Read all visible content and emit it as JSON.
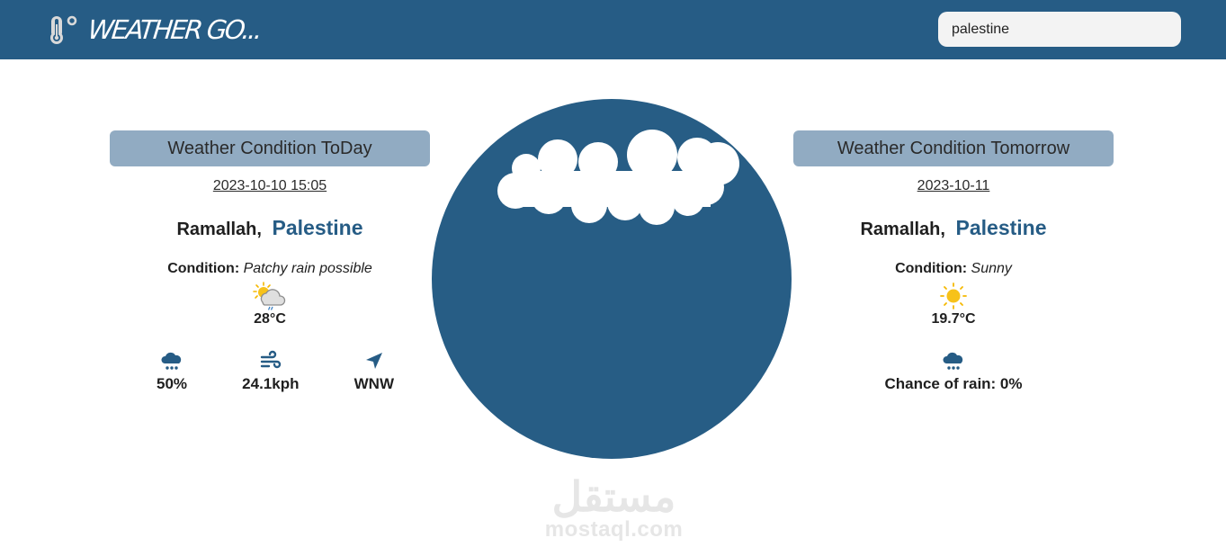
{
  "app": {
    "brand": "WEATHER GO...",
    "brand_icon": "thermometer-degree-icon"
  },
  "search": {
    "value": "palestine",
    "placeholder": ""
  },
  "today": {
    "header": "Weather Condition ToDay",
    "datetime": "2023-10-10 15:05",
    "city": "Ramallah,",
    "country": "Palestine",
    "condition_label": "Condition:",
    "condition_value": "Patchy rain possible",
    "condition_icon": "patchy-rain-icon",
    "temperature": "28°C",
    "stats": [
      {
        "icon": "cloud-rain-icon",
        "value": "50%"
      },
      {
        "icon": "wind-icon",
        "value": "24.1kph"
      },
      {
        "icon": "direction-arrow-icon",
        "value": "WNW"
      }
    ]
  },
  "tomorrow": {
    "header": "Weather Condition Tomorrow",
    "date": "2023-10-11",
    "city": "Ramallah,",
    "country": "Palestine",
    "condition_label": "Condition:",
    "condition_value": "Sunny",
    "condition_icon": "sun-icon",
    "temperature": "19.7°C",
    "rain_chance": "Chance of rain: 0%"
  },
  "hero": {
    "illustration": "rain-cloud-illustration"
  },
  "watermark": {
    "arabic": "مستقل",
    "latin": "mostaql.com"
  },
  "colors": {
    "primary": "#265c85",
    "header_card": "#91abc2",
    "search_bg": "#f3f3f3"
  }
}
